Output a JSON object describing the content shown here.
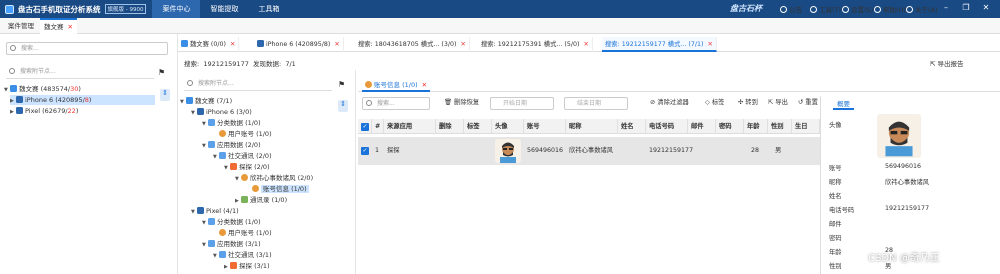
{
  "app": {
    "title": "盘古石手机取证分析系统",
    "version": "旗舰版 - 9900",
    "brand": "盘古石杯"
  },
  "menu": [
    "案件中心",
    "智能提取",
    "工具箱"
  ],
  "top_right": {
    "notice": "公告",
    "tools": "工具(T)",
    "settings": "设置(S)",
    "help": "帮助(H)",
    "about": "关于(A)"
  },
  "tabs1": [
    "案件管理",
    "魏文赛"
  ],
  "left": {
    "search_placeholder": "搜索...",
    "filter_placeholder": "搜索附节点...",
    "root": {
      "name": "魏文赛",
      "count": "(483574/",
      "count_red": "30",
      "tail": ")"
    },
    "devices": [
      {
        "name": "iPhone 6",
        "count": "(420895/",
        "count_red": "8",
        "tail": ")"
      },
      {
        "name": "Pixel",
        "count": "(62679/",
        "count_red": "22",
        "tail": ")"
      }
    ]
  },
  "tabs2": [
    {
      "label": "魏文赛",
      "count": "(0/0)"
    },
    {
      "label": "iPhone 6",
      "count": "(420895/8)"
    },
    {
      "label": "搜索: 18043618705 横式...",
      "count": "(3/0)"
    },
    {
      "label": "搜索: 19212175391 横式...",
      "count": "(5/0)"
    },
    {
      "label": "搜索: 19212159177 横式...",
      "count": "(7/1)"
    }
  ],
  "info": {
    "search_label": "搜索:",
    "search_value": "19212159177",
    "found_label": "发现数据:",
    "found_value": "7/1",
    "export": "导出报告"
  },
  "tree": {
    "filter_placeholder": "搜索附节点...",
    "nodes": [
      {
        "label": "魏文赛 (7/1)"
      },
      {
        "label": "iPhone 6 (3/0)"
      },
      {
        "label": "分类数据 (1/0)"
      },
      {
        "label": "用户账号 (1/0)"
      },
      {
        "label": "应用数据 (2/0)"
      },
      {
        "label": "社交通讯 (2/0)"
      },
      {
        "label": "探探 (2/0)"
      },
      {
        "label": "欣祎心事数诸风 (2/0)"
      },
      {
        "label": "账号信息 (1/0)"
      },
      {
        "label": "通讯录 (1/0)"
      },
      {
        "label": "Pixel (4/1)"
      },
      {
        "label": "分类数据 (1/0)"
      },
      {
        "label": "用户账号 (1/0)"
      },
      {
        "label": "应用数据 (3/1)"
      },
      {
        "label": "社交通讯 (3/1)"
      },
      {
        "label": "探探 (3/1)"
      }
    ]
  },
  "subtab": {
    "label": "账号信息",
    "count": "(1/0)"
  },
  "toolbar": {
    "search_placeholder": "搜索...",
    "delete_restore": "删除恢复",
    "start_date": "开始日期",
    "end_date": "结束日期",
    "clear_filter": "清除过滤器",
    "tag": "标签",
    "transfer": "转到",
    "export": "导出",
    "reset": "重置"
  },
  "grid": {
    "headers": [
      "#",
      "来源应用",
      "删除",
      "标签",
      "头像",
      "账号",
      "昵称",
      "姓名",
      "电话号码",
      "邮件",
      "密码",
      "年龄",
      "性别",
      "生日"
    ],
    "row": {
      "index": "1",
      "source": "探探",
      "account": "569496016",
      "nickname": "欣祎心事数诸风",
      "phone": "19212159177",
      "age": "28",
      "gender": "男"
    }
  },
  "detail": {
    "tab": "概要",
    "avatar_label": "头像",
    "fields": [
      {
        "label": "账号",
        "value": "569496016"
      },
      {
        "label": "昵称",
        "value": "欣祎心事数诸风"
      },
      {
        "label": "姓名",
        "value": ""
      },
      {
        "label": "电话号码",
        "value": "19212159177"
      },
      {
        "label": "邮件",
        "value": ""
      },
      {
        "label": "密码",
        "value": ""
      },
      {
        "label": "年龄",
        "value": "28"
      },
      {
        "label": "性别",
        "value": "男"
      }
    ]
  },
  "watermark": "CSDN @奇乃正"
}
